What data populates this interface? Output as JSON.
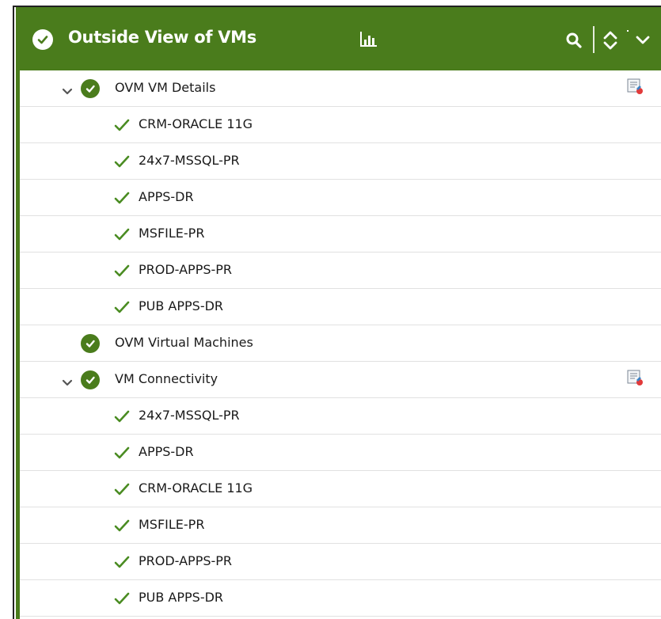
{
  "header": {
    "title": "Outside View of VMs",
    "status_icon": "check-circle-icon",
    "chart_icon": "bar-chart-icon",
    "search_icon": "search-icon",
    "sort_icon": "sort-icon",
    "collapse_icon": "chevron-down-icon"
  },
  "colors": {
    "header_bg": "#4a7c1c",
    "check_green": "#4a8c22",
    "border_gray": "#e1e1e1"
  },
  "tree": {
    "groups": [
      {
        "label": "OVM VM Details",
        "expanded": true,
        "has_action": true,
        "children": [
          "CRM-ORACLE 11G",
          "24x7-MSSQL-PR",
          "APPS-DR",
          "MSFILE-PR",
          "PROD-APPS-PR",
          "PUB APPS-DR"
        ]
      },
      {
        "label": "OVM Virtual Machines",
        "expanded": false,
        "has_action": false,
        "children": []
      },
      {
        "label": "VM Connectivity",
        "expanded": true,
        "has_action": true,
        "children": [
          "24x7-MSSQL-PR",
          "APPS-DR",
          "CRM-ORACLE 11G",
          "MSFILE-PR",
          "PROD-APPS-PR",
          "PUB APPS-DR"
        ]
      }
    ]
  }
}
